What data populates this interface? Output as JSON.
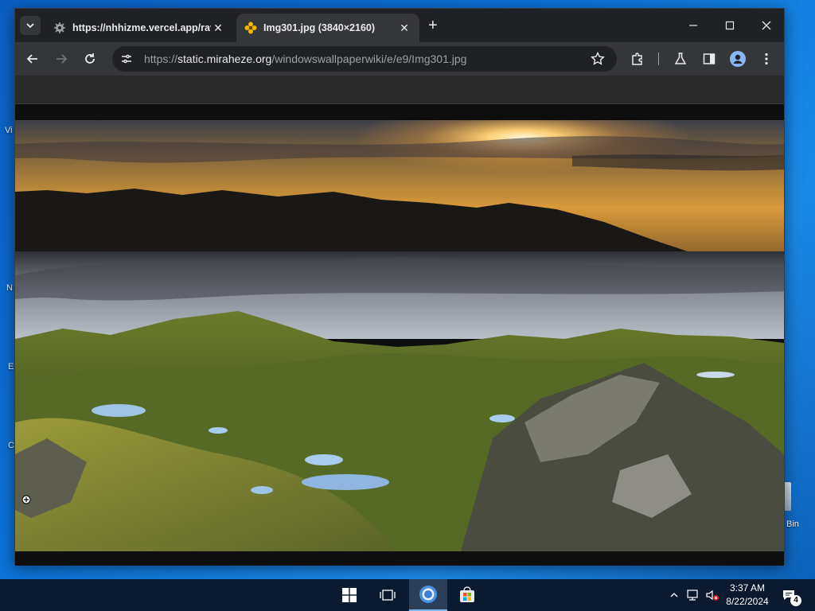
{
  "desktop": {
    "labels": [
      "Vi",
      "N",
      "E",
      "C"
    ],
    "recycle_bin_label": "Bin"
  },
  "browser": {
    "tabs": [
      {
        "title": "https://nhhizme.vercel.app/rav",
        "icon": "gear-favicon",
        "active": false
      },
      {
        "title": "Img301.jpg (3840×2160)",
        "icon": "flower-favicon",
        "active": true
      }
    ],
    "close_glyph": "✕",
    "new_tab_glyph": "+",
    "url_scheme": "https://",
    "url_host": "static.miraheze.org",
    "url_path": "/windowswallpaperwiki/e/e9/Img301.jpg",
    "window_controls": [
      "minimize-icon",
      "maximize-icon",
      "close-icon"
    ]
  },
  "taskbar": {
    "apps": [
      "windows-start-icon",
      "task-view-icon",
      "chrome-icon",
      "store-icon"
    ],
    "clock_time": "3:37 AM",
    "clock_date": "8/22/2024",
    "notification_count": "4"
  },
  "colors": {
    "accent": "#7db7ef",
    "chrome_bg": "#202124",
    "toolbar_bg": "#35363a",
    "taskbar_bg": "#0b1a2e"
  }
}
